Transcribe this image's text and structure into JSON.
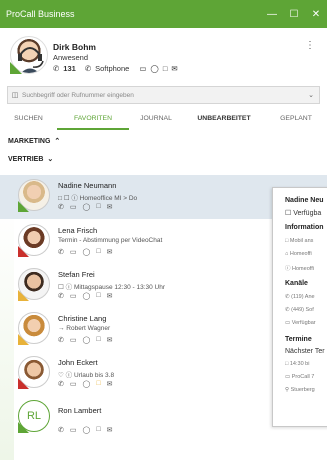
{
  "app": {
    "title": "ProCall Business"
  },
  "window": {
    "minimize": "—",
    "maximize": "☐",
    "close": "✕"
  },
  "profile": {
    "name": "Dirk Bohm",
    "status": "Anwesend",
    "extension": "131",
    "softphone": "Softphone"
  },
  "search": {
    "placeholder": "Suchbegriff oder Rufnummer eingeben"
  },
  "tabs": [
    {
      "label": "SUCHEN"
    },
    {
      "label": "FAVORITEN"
    },
    {
      "label": "JOURNAL"
    },
    {
      "label": "UNBEARBEITET"
    },
    {
      "label": "GEPLANT"
    }
  ],
  "groups": [
    {
      "label": "MARKETING",
      "chevron": "^"
    },
    {
      "label": "VERTRIEB",
      "chevron": "v"
    }
  ],
  "contacts": [
    {
      "name": "Nadine Neumann",
      "status": "Homeoffice MI > Do"
    },
    {
      "name": "Lena Frisch",
      "status": "Termin - Abstimmung per VideoChat"
    },
    {
      "name": "Stefan Frei",
      "status": "Mittagspause 12:30 - 13:30 Uhr"
    },
    {
      "name": "Christine Lang",
      "status": "→ Robert Wagner"
    },
    {
      "name": "John Eckert",
      "status": "Urlaub bis 3.8"
    },
    {
      "name": "Ron Lambert",
      "status": "",
      "initials": "RL"
    }
  ],
  "popup": {
    "name": "Nadine Neu",
    "availability": "Verfügba",
    "section_info": "Information",
    "info": [
      "Mobil ans",
      "Homeoffi",
      "Homeoffi"
    ],
    "section_channels": "Kanäle",
    "channels": [
      "(119) Ane",
      "(449) Sof",
      "Verfügbar"
    ],
    "section_dates": "Termine",
    "next": "Nächster Ter",
    "dates": [
      "14:30 bi",
      "ProCall 7",
      "Stuerberg"
    ]
  },
  "colors": {
    "accent": "#5ea536",
    "selected": "#dfe7ee",
    "busy": "#c9302c",
    "away": "#e8b23a"
  }
}
